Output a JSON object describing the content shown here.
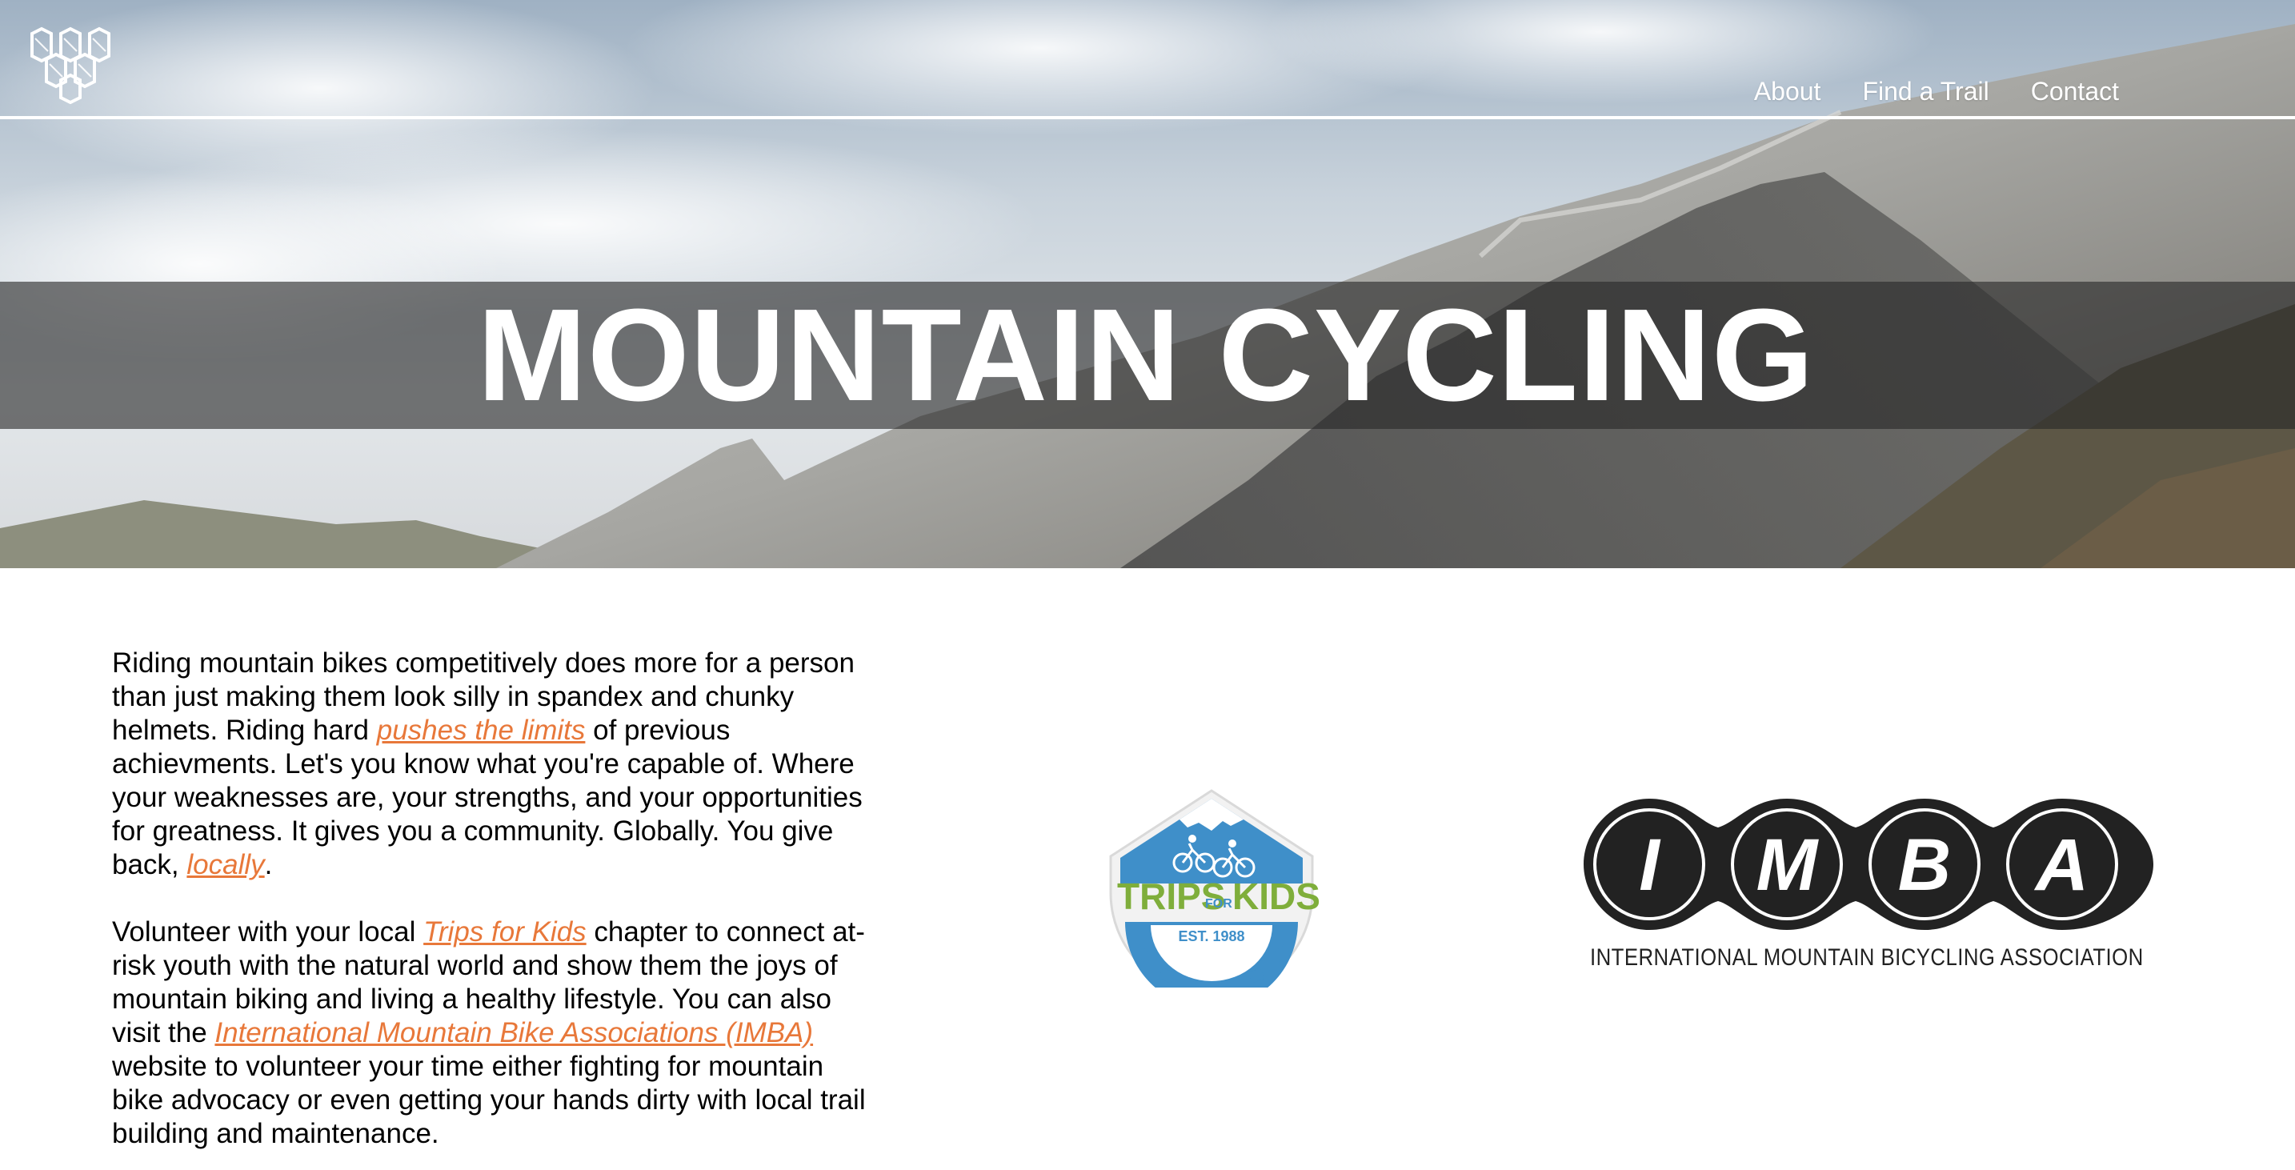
{
  "nav": {
    "links": [
      "About",
      "Find a Trail",
      "Contact"
    ]
  },
  "hero": {
    "title": "MOUNTAIN CYCLING"
  },
  "content": {
    "p1_a": "Riding mountain bikes competitively does more for a person than just making them look silly in spandex and chunky helmets. Riding hard ",
    "p1_link1": "pushes the limits",
    "p1_b": " of previous achievments. Let's you know what you're capable of. Where your weaknesses are, your strengths, and your opportunities for greatness. It gives you a community. Globally. You give back, ",
    "p1_link2": "locally",
    "p1_c": ".",
    "p2_a": "Volunteer with your local ",
    "p2_link1": "Trips for Kids",
    "p2_b": " chapter to connect at-risk youth with the natural world and show them the joys of mountain biking and living a healthy lifestyle. You can also visit the ",
    "p2_link2": "International Mountain Bike Associations (IMBA)",
    "p2_c": " website to volunteer your time either fighting for mountain bike advocacy or even getting your hands dirty with local trail building and maintenance."
  },
  "logos": {
    "tfk_top": "TRIPS",
    "tfk_for": "FOR",
    "tfk_bottom": "KIDS",
    "tfk_est": "EST. 1988",
    "imba_letters": [
      "I",
      "M",
      "B",
      "A"
    ],
    "imba_caption": "INTERNATIONAL MOUNTAIN BICYCLING ASSOCIATION"
  },
  "colors": {
    "accent": "#e8783a",
    "tfk_blue": "#3f8fc9",
    "tfk_green": "#7fae3b",
    "imba_dark": "#222222"
  }
}
